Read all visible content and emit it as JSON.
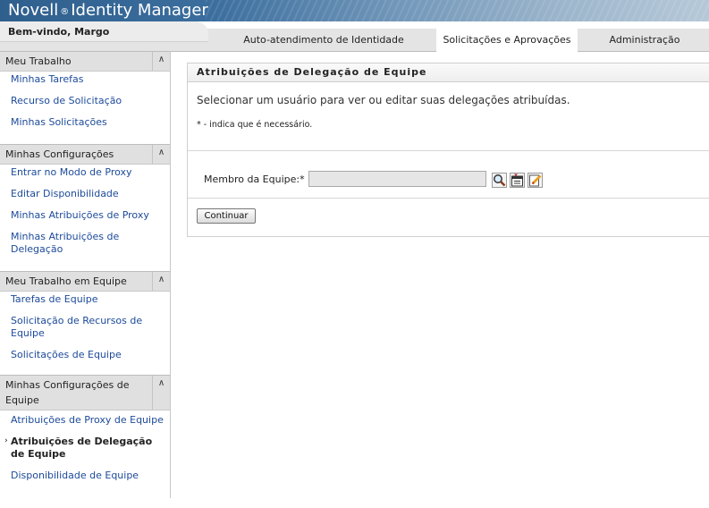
{
  "app": {
    "brand_name": "Novell",
    "brand_registered": "®",
    "brand_product": "Identity Manager"
  },
  "header": {
    "welcome": "Bem-vindo, Margo"
  },
  "tabs": [
    {
      "label": "Auto-atendimento de Identidade",
      "active": false
    },
    {
      "label": "Solicitações e Aprovações",
      "active": true
    },
    {
      "label": "Administração",
      "active": false
    }
  ],
  "sidebar": {
    "groups": [
      {
        "title": "Meu Trabalho",
        "items": [
          "Minhas Tarefas",
          "Recurso de Solicitação",
          "Minhas Solicitações"
        ]
      },
      {
        "title": "Minhas Configurações",
        "items": [
          "Entrar no Modo de Proxy",
          "Editar Disponibilidade",
          "Minhas Atribuições de Proxy",
          "Minhas Atribuições de Delegação"
        ]
      },
      {
        "title": "Meu Trabalho em Equipe",
        "items": [
          "Tarefas de Equipe",
          "Solicitação de Recursos de Equipe",
          "Solicitações de Equipe"
        ]
      },
      {
        "title": "Minhas Configurações de Equipe",
        "items": [
          "Atribuições de Proxy de Equipe",
          "Atribuições de Delegação de Equipe",
          "Disponibilidade de Equipe"
        ],
        "current_item": "Atribuições de Delegação de Equipe"
      }
    ],
    "collapse_icon": "double-chevron-up-icon"
  },
  "panel": {
    "title": "Atribuições de Delegação de Equipe",
    "info": "Selecionar um usuário para ver ou editar suas delegações atribuídas.",
    "required_note": "* - indica que é necessário.",
    "field_label": "Membro da Equipe:*",
    "field_value": "",
    "field_icons": [
      "search-icon",
      "history-list-icon",
      "clear-edit-icon"
    ],
    "continue_label": "Continuar"
  },
  "colors": {
    "link": "#1c4a9a",
    "banner": "#3b6e9e"
  }
}
